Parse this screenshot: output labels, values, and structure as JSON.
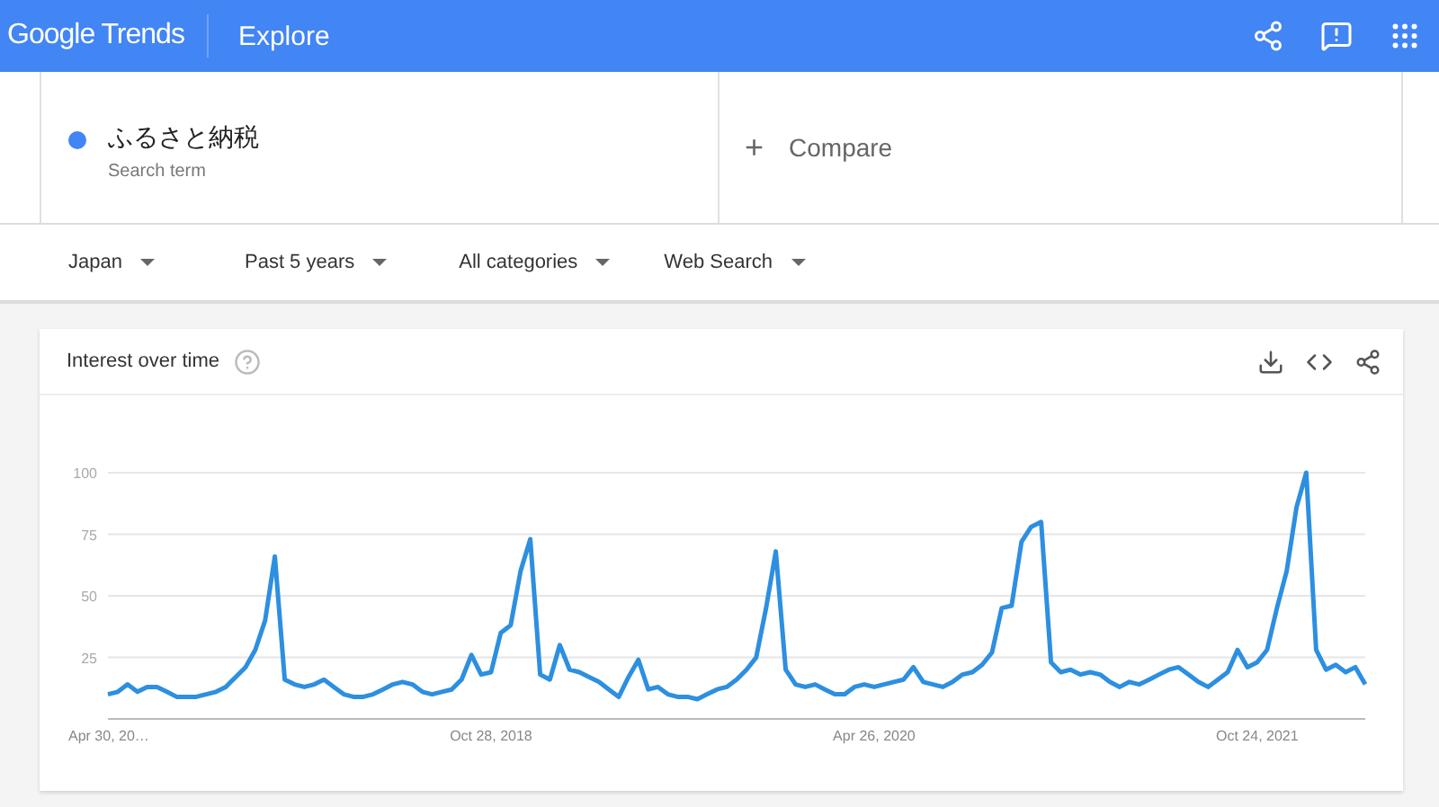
{
  "header": {
    "logo": "Google Trends",
    "title": "Explore"
  },
  "search": {
    "term": "ふるさと納税",
    "caption": "Search term",
    "compare": "Compare",
    "compare_icon": "+"
  },
  "filters": [
    {
      "label": "Japan"
    },
    {
      "label": "Past 5 years"
    },
    {
      "label": "All categories"
    },
    {
      "label": "Web Search"
    }
  ],
  "card": {
    "title": "Interest over time",
    "x_labels": [
      "Apr 30, 20…",
      "Oct 28, 2018",
      "Apr 26, 2020",
      "Oct 24, 2021"
    ],
    "chart_data": {
      "type": "line",
      "grid": true,
      "ylim": [
        0,
        100
      ],
      "yticks": [
        {
          "value": 25,
          "label": "25"
        },
        {
          "value": 50,
          "label": "50"
        },
        {
          "value": 75,
          "label": "75"
        },
        {
          "value": 100,
          "label": "100"
        }
      ],
      "series": [
        {
          "color": "#2d8fe0",
          "values": [
            10,
            11,
            14,
            11,
            13,
            13,
            11,
            9,
            9,
            9,
            10,
            11,
            13,
            17,
            21,
            28,
            40,
            66,
            16,
            14,
            13,
            14,
            16,
            13,
            10,
            9,
            9,
            10,
            12,
            14,
            15,
            14,
            11,
            10,
            11,
            12,
            16,
            26,
            18,
            19,
            35,
            38,
            60,
            73,
            18,
            16,
            30,
            20,
            19,
            17,
            15,
            12,
            9,
            17,
            24,
            12,
            13,
            10,
            9,
            9,
            8,
            10,
            12,
            13,
            16,
            20,
            25,
            45,
            68,
            20,
            14,
            13,
            14,
            12,
            10,
            10,
            13,
            14,
            13,
            14,
            15,
            16,
            21,
            15,
            14,
            13,
            15,
            18,
            19,
            22,
            27,
            45,
            46,
            72,
            78,
            80,
            23,
            19,
            20,
            18,
            19,
            18,
            15,
            13,
            15,
            14,
            16,
            18,
            20,
            21,
            18,
            15,
            13,
            16,
            19,
            28,
            21,
            23,
            28,
            45,
            60,
            86,
            100,
            28,
            20,
            22,
            19,
            21,
            14
          ]
        }
      ]
    }
  }
}
